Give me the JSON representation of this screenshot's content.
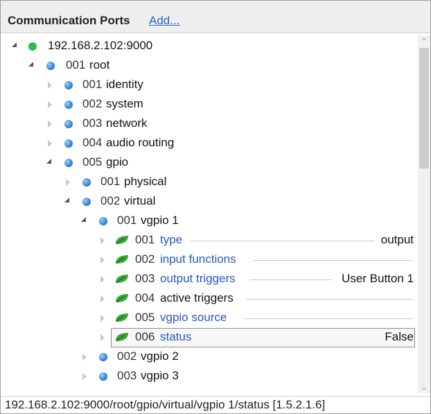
{
  "header": {
    "title": "Communication Ports",
    "add_link": "Add..."
  },
  "tree": {
    "rows": [
      {
        "id": "root-ip",
        "num": "",
        "label": "192.168.2.102:9000",
        "value": "",
        "icon": "green-dot",
        "expander": "open",
        "link": false
      },
      {
        "id": "root",
        "num": "001",
        "label": "root",
        "value": "",
        "icon": "blue-dot",
        "expander": "open",
        "link": false
      },
      {
        "id": "identity",
        "num": "001",
        "label": "identity",
        "value": "",
        "icon": "blue-dot",
        "expander": "closed",
        "link": false
      },
      {
        "id": "system",
        "num": "002",
        "label": "system",
        "value": "",
        "icon": "blue-dot",
        "expander": "closed",
        "link": false
      },
      {
        "id": "network",
        "num": "003",
        "label": "network",
        "value": "",
        "icon": "blue-dot",
        "expander": "closed",
        "link": false
      },
      {
        "id": "audio-routing",
        "num": "004",
        "label": "audio routing",
        "value": "",
        "icon": "blue-dot",
        "expander": "closed",
        "link": false
      },
      {
        "id": "gpio",
        "num": "005",
        "label": "gpio",
        "value": "",
        "icon": "blue-dot",
        "expander": "open",
        "link": false
      },
      {
        "id": "physical",
        "num": "001",
        "label": "physical",
        "value": "",
        "icon": "blue-dot",
        "expander": "closed",
        "link": false
      },
      {
        "id": "virtual",
        "num": "002",
        "label": "virtual",
        "value": "",
        "icon": "blue-dot",
        "expander": "open",
        "link": false
      },
      {
        "id": "vgpio-1",
        "num": "001",
        "label": "vgpio 1",
        "value": "",
        "icon": "blue-dot",
        "expander": "open",
        "link": false
      },
      {
        "id": "type",
        "num": "001",
        "label": "type",
        "value": "output",
        "icon": "leaf",
        "expander": "closed",
        "link": true
      },
      {
        "id": "input-functions",
        "num": "002",
        "label": "input functions",
        "value": "",
        "icon": "leaf",
        "expander": "closed",
        "link": true
      },
      {
        "id": "output-triggers",
        "num": "003",
        "label": "output triggers",
        "value": "User Button 1",
        "icon": "leaf",
        "expander": "closed",
        "link": true
      },
      {
        "id": "active-triggers",
        "num": "004",
        "label": "active triggers",
        "value": "",
        "icon": "leaf",
        "expander": "closed",
        "link": false
      },
      {
        "id": "vgpio-source",
        "num": "005",
        "label": "vgpio source",
        "value": "",
        "icon": "leaf",
        "expander": "closed",
        "link": true
      },
      {
        "id": "status",
        "num": "006",
        "label": "status",
        "value": "False",
        "icon": "leaf",
        "expander": "closed",
        "link": true
      },
      {
        "id": "vgpio-2",
        "num": "002",
        "label": "vgpio 2",
        "value": "",
        "icon": "blue-dot",
        "expander": "closed",
        "link": false
      },
      {
        "id": "vgpio-3",
        "num": "003",
        "label": "vgpio 3",
        "value": "",
        "icon": "blue-dot",
        "expander": "closed",
        "link": false
      }
    ]
  },
  "status_bar": {
    "path": "192.168.2.102:9000/root/gpio/virtual/vgpio 1/status [1.5.2.1.6]"
  },
  "colors": {
    "link": "#2557bf",
    "green_dot": "#2fbb4a",
    "blue_dot": "#3a86d8",
    "leaf": "#3aa83a"
  },
  "icons": {
    "scroll_up": "chevron-up-icon",
    "scroll_down": "chevron-down-icon"
  }
}
